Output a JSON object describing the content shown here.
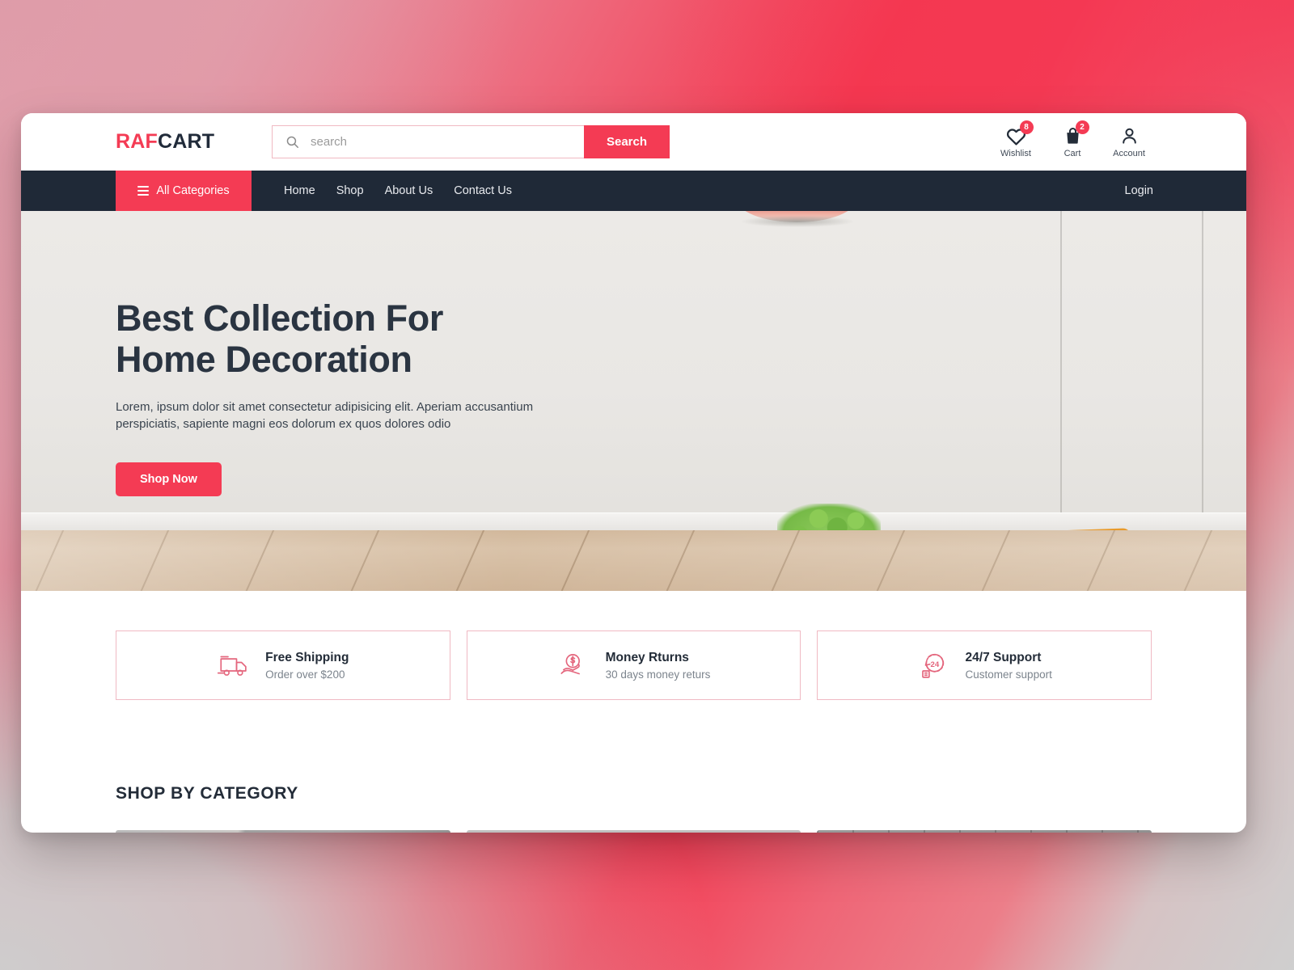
{
  "brand": {
    "logo_primary": "RAF",
    "logo_secondary": "CART",
    "accent_color": "#f43b54",
    "dark_color": "#1f2937"
  },
  "search": {
    "placeholder": "search",
    "value": "",
    "button_label": "Search",
    "icon": "search-icon"
  },
  "header_actions": [
    {
      "label": "Wishlist",
      "badge": "8",
      "icon": "heart-icon"
    },
    {
      "label": "Cart",
      "badge": "2",
      "icon": "shopping-bag-icon"
    },
    {
      "label": "Account",
      "badge": "",
      "icon": "user-icon"
    }
  ],
  "nav": {
    "all_categories": "All Categories",
    "menu_icon": "hamburger-icon",
    "links": [
      "Home",
      "Shop",
      "About Us",
      "Contact Us"
    ],
    "login": "Login"
  },
  "hero": {
    "title_line1": "Best Collection For",
    "title_line2": "Home Decoration",
    "subtitle": "Lorem, ipsum dolor sit amet consectetur adipisicing elit. Aperiam accusantium perspiciatis, sapiente magni eos dolorum ex quos dolores odio",
    "cta_label": "Shop Now"
  },
  "features": [
    {
      "title": "Free Shipping",
      "subtitle": "Order over $200",
      "icon": "delivery-truck-icon"
    },
    {
      "title": "Money Rturns",
      "subtitle": "30 days money returs",
      "icon": "money-return-hand-icon"
    },
    {
      "title": "24/7 Support",
      "subtitle": "Customer support",
      "icon": "support-24-icon"
    }
  ],
  "category_section": {
    "title": "SHOP BY CATEGORY",
    "cards": [
      "",
      "",
      ""
    ]
  }
}
